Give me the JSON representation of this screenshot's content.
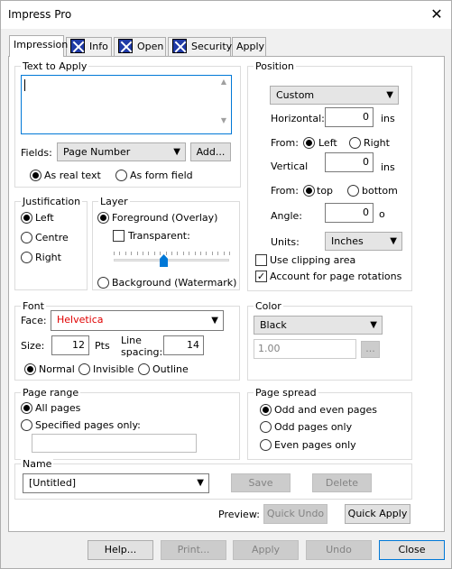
{
  "window": {
    "title": "Impress Pro",
    "close_glyph": "✕"
  },
  "tabs": [
    {
      "label": "Impression",
      "active": true,
      "icon": ""
    },
    {
      "label": "Info",
      "icon": "x-box-icon"
    },
    {
      "label": "Open",
      "icon": "x-box-icon"
    },
    {
      "label": "Security",
      "icon": "x-box-icon"
    },
    {
      "label": "Apply",
      "icon": ""
    }
  ],
  "text_to_apply": {
    "legend": "Text to Apply",
    "text_value": "",
    "fields_label": "Fields:",
    "fields_value": "Page Number",
    "add_button": "Add...",
    "as_real_text": "As real text",
    "as_form_field": "As form field"
  },
  "justification": {
    "legend": "Justification",
    "left": "Left",
    "centre": "Centre",
    "right": "Right"
  },
  "layer": {
    "legend": "Layer",
    "foreground": "Foreground (Overlay)",
    "transparent": "Transparent:",
    "background": "Background (Watermark)",
    "slider_level_percent": 43
  },
  "position": {
    "legend": "Position",
    "mode": "Custom",
    "horizontal_label": "Horizontal:",
    "horizontal_value": "0",
    "horizontal_unit": "ins",
    "from1_label": "From:",
    "left": "Left",
    "right": "Right",
    "vertical_label": "Vertical",
    "vertical_value": "0",
    "vertical_unit": "ins",
    "from2_label": "From:",
    "top": "top",
    "bottom": "bottom",
    "angle_label": "Angle:",
    "angle_value": "0",
    "angle_unit": "o",
    "units_label": "Units:",
    "units_value": "Inches",
    "use_clipping": "Use clipping area",
    "account_rotations": "Account for page rotations"
  },
  "font": {
    "legend": "Font",
    "face_label": "Face:",
    "face_value": "Helvetica",
    "face_color": "#e00000",
    "size_label": "Size:",
    "size_value": "12",
    "size_unit": "Pts",
    "line_label1": "Line",
    "line_label2": "spacing:",
    "line_value": "14",
    "normal": "Normal",
    "invisible": "Invisible",
    "outline": "Outline"
  },
  "color": {
    "legend": "Color",
    "value": "Black",
    "opacity": "1.00",
    "picker": "..."
  },
  "page_range": {
    "legend": "Page range",
    "all_pages": "All pages",
    "specified_pages": "Specified pages only:",
    "pages_value": ""
  },
  "page_spread": {
    "legend": "Page spread",
    "odd_even": "Odd and even pages",
    "odd_only": "Odd pages only",
    "even_only": "Even pages only"
  },
  "name": {
    "legend": "Name",
    "value": "[Untitled]",
    "save": "Save",
    "delete": "Delete"
  },
  "preview": {
    "label": "Preview:",
    "quick_undo": "Quick Undo",
    "quick_apply": "Quick Apply"
  },
  "bottom_buttons": {
    "help": "Help...",
    "print": "Print...",
    "apply": "Apply",
    "undo": "Undo",
    "close": "Close"
  }
}
